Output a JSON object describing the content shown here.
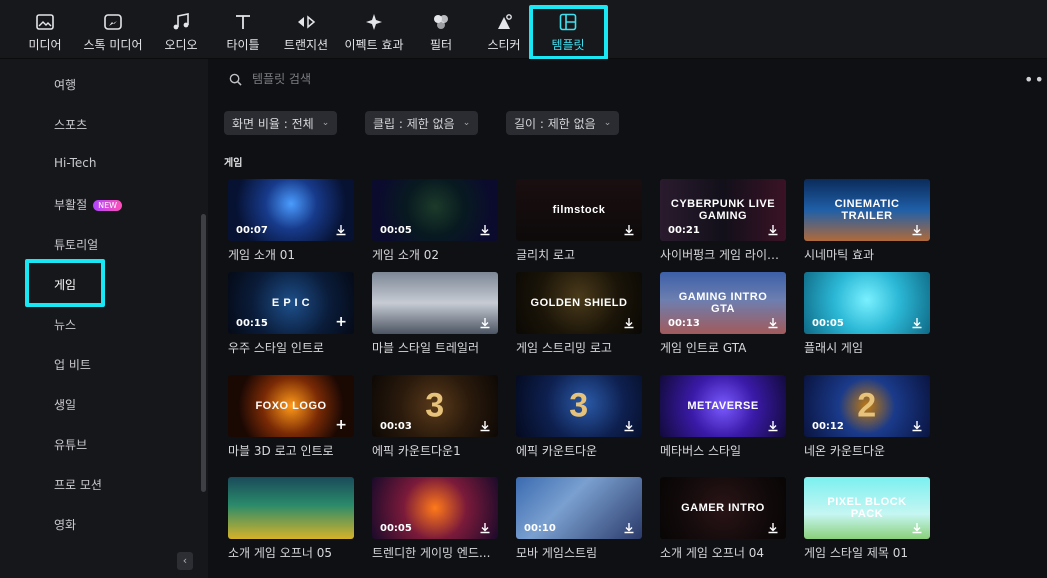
{
  "toolbar": {
    "items": [
      {
        "label": "미디어",
        "icon": "media-icon"
      },
      {
        "label": "스톡 미디어",
        "icon": "stock-media-icon"
      },
      {
        "label": "오디오",
        "icon": "music-note-icon"
      },
      {
        "label": "타이틀",
        "icon": "text-t-icon"
      },
      {
        "label": "트랜지션",
        "icon": "transition-arrows-icon"
      },
      {
        "label": "이펙트 효과",
        "icon": "sparkle-icon"
      },
      {
        "label": "필터",
        "icon": "filter-circles-icon"
      },
      {
        "label": "스티커",
        "icon": "sticker-icon"
      },
      {
        "label": "템플릿",
        "icon": "template-grid-icon"
      }
    ],
    "active": "템플릿"
  },
  "sidebar": {
    "items": [
      {
        "label": "여행"
      },
      {
        "label": "스포츠"
      },
      {
        "label": "Hi-Tech"
      },
      {
        "label": "부활절",
        "badge": "NEW"
      },
      {
        "label": "튜토리얼"
      },
      {
        "label": "게임"
      },
      {
        "label": "뉴스"
      },
      {
        "label": "업 비트"
      },
      {
        "label": "생일"
      },
      {
        "label": "유튜브"
      },
      {
        "label": "프로 모션"
      },
      {
        "label": "영화"
      }
    ],
    "active": "게임",
    "collapse_glyph": "‹"
  },
  "search": {
    "placeholder": "템플릿 검색"
  },
  "filters": [
    {
      "label": "화면 비율 : 전체"
    },
    {
      "label": "클립 : 제한 없음"
    },
    {
      "label": "길이 : 제한 없음"
    }
  ],
  "section": {
    "title": "게임"
  },
  "cards": [
    {
      "label": "게임 소개 01",
      "duration": "00:07",
      "action": "download",
      "thumb_text": "",
      "bg": "radial-gradient(circle at 50% 40%, #4a9cff 0%, #173a8a 35%, #071233 75%)"
    },
    {
      "label": "게임 소개 02",
      "duration": "00:05",
      "action": "download",
      "thumb_text": "",
      "bg": "radial-gradient(circle at 50% 45%, #1c3a2a 0%, #081a20 40%, #0b0b2e 80%)"
    },
    {
      "label": "글리치 로고",
      "duration": "",
      "action": "download",
      "thumb_text": "filmstock",
      "bg": "linear-gradient(180deg, #1a0e10 0%, #0d0a0a 100%)"
    },
    {
      "label": "사이버펑크 게임 라이브...",
      "duration": "00:21",
      "action": "download",
      "thumb_text": "CYBERPUNK LIVE GAMING",
      "bg": "linear-gradient(90deg, #2a1b2e 0%, #12101a 50%, #3a1225 100%)"
    },
    {
      "label": "시네마틱 효과",
      "duration": "",
      "action": "download",
      "thumb_text": "CINEMATIC TRAILER",
      "bg": "linear-gradient(180deg, #0b2b5a 0%, #1f5fa8 50%, #b06a3a 100%)"
    },
    {
      "label": "우주 스타일 인트로",
      "duration": "00:15",
      "action": "add",
      "thumb_text": "E P I C",
      "bg": "radial-gradient(circle at 50% 50%, #1d4f8a 0%, #0a1c3a 55%, #050a16 100%)"
    },
    {
      "label": "마블 스타일 트레일러",
      "duration": "",
      "action": "download",
      "thumb_text": "",
      "bg": "linear-gradient(180deg, #7d8796 0%, #c7ccd4 50%, #4c5563 100%)"
    },
    {
      "label": "게임 스트리밍 로고",
      "duration": "",
      "action": "download",
      "thumb_text": "GOLDEN SHIELD",
      "bg": "radial-gradient(circle at 50% 40%, #4a3a1a 0%, #1a1408 55%, #0a0805 100%)"
    },
    {
      "label": "게임 인트로 GTA",
      "duration": "00:13",
      "action": "download",
      "thumb_text": "GAMING INTRO GTA",
      "bg": "linear-gradient(180deg, #3c5fa8 0%, #6d7fb0 45%, #a25a5a 100%)"
    },
    {
      "label": "플래시 게임",
      "duration": "00:05",
      "action": "download",
      "thumb_text": "",
      "bg": "radial-gradient(circle at 50% 45%, #7af0ff 0%, #2bb8d6 45%, #0f6a86 100%)"
    },
    {
      "label": "마블 3D 로고 인트로",
      "duration": "",
      "action": "add",
      "thumb_text": "FOXO LOGO",
      "bg": "radial-gradient(circle at 50% 50%, #ff9a1a 0%, #7a2a05 40%, #1a0803 75%)"
    },
    {
      "label": "에픽 카운트다운1",
      "duration": "00:03",
      "action": "download",
      "thumb_text": "3",
      "bg": "radial-gradient(circle at 50% 50%, #5a3a1a 0%, #2a1a0c 50%, #0d0805 100%)"
    },
    {
      "label": "에픽 카운트다운",
      "duration": "",
      "action": "download",
      "thumb_text": "3",
      "bg": "radial-gradient(circle at 55% 45%, #2a5aa8 0%, #0e2050 50%, #040a1e 100%)"
    },
    {
      "label": "메타버스 스타일",
      "duration": "",
      "action": "download",
      "thumb_text": "METAVERSE",
      "bg": "radial-gradient(circle at 50% 50%, #7a5aff 0%, #3a1aa8 45%, #120a3a 100%)"
    },
    {
      "label": "네온 카운트다운",
      "duration": "00:12",
      "action": "download",
      "thumb_text": "2",
      "bg": "radial-gradient(circle at 50% 50%, #c07a10 0%, #1a3a8a 40%, #0a1440 100%)"
    },
    {
      "label": "소개 게임 오프너 05",
      "duration": "",
      "action": "",
      "thumb_text": "",
      "bg": "linear-gradient(180deg, #1a4a5a 0%, #2a8a6a 45%, #d6b22a 100%)"
    },
    {
      "label": "트렌디한 게이밍 엔드...",
      "duration": "00:05",
      "action": "download",
      "thumb_text": "",
      "bg": "radial-gradient(circle at 50% 50%, #ff7a1a 0%, #7a1a3a 45%, #1a0a2a 100%)"
    },
    {
      "label": "모바 게임스트림",
      "duration": "00:10",
      "action": "download",
      "thumb_text": "",
      "bg": "linear-gradient(135deg, #3a6ab0 0%, #7aa0d0 40%, #2a3a6a 100%)"
    },
    {
      "label": "소개 게임 오프너 04",
      "duration": "",
      "action": "download",
      "thumb_text": "GAMER INTRO",
      "bg": "radial-gradient(circle at 50% 50%, #2a1416 0%, #120a0b 60%, #080505 100%)"
    },
    {
      "label": "게임 스타일 제목 01",
      "duration": "",
      "action": "download",
      "thumb_text": "PIXEL BLOCK PACK",
      "bg": "linear-gradient(180deg, #7af0f0 0%, #c6f6f2 60%, #8ad07a 100%)"
    }
  ],
  "colors": {
    "accent": "#19e8f4",
    "badge": "#c04ad8"
  }
}
